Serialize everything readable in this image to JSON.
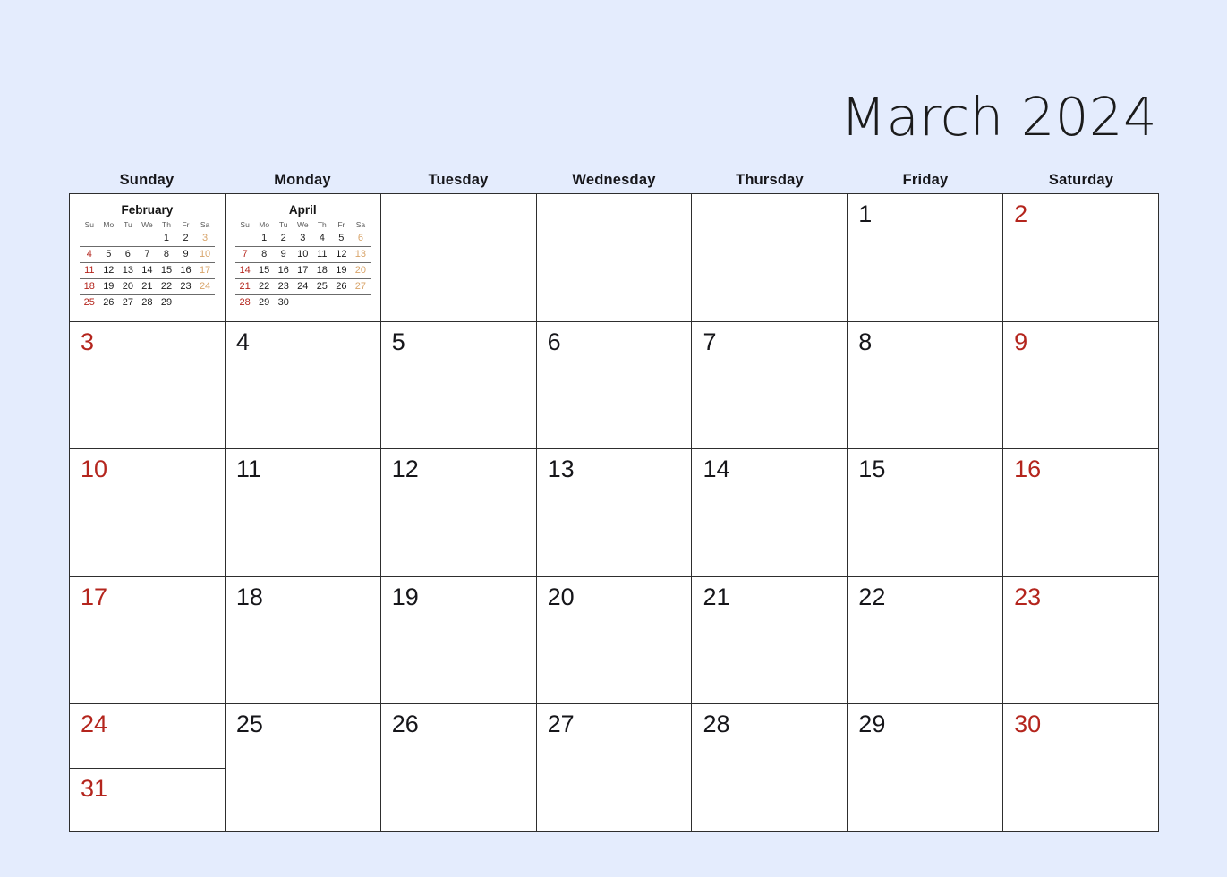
{
  "title": "March 2024",
  "background_color": "#e4ecfd",
  "weekend_color": "#b4251d",
  "weekday_color": "#16161a",
  "mini_saturday_color": "#d8a46a",
  "weekdays": [
    {
      "label": "Sunday"
    },
    {
      "label": "Monday"
    },
    {
      "label": "Tuesday"
    },
    {
      "label": "Wednesday"
    },
    {
      "label": "Thursday"
    },
    {
      "label": "Friday"
    },
    {
      "label": "Saturday"
    }
  ],
  "mini_calendars": {
    "previous": {
      "title": "February",
      "headers": [
        "Su",
        "Mo",
        "Tu",
        "We",
        "Th",
        "Fr",
        "Sa"
      ],
      "weeks": [
        [
          "",
          "",
          "",
          "",
          "1",
          "2",
          "3"
        ],
        [
          "4",
          "5",
          "6",
          "7",
          "8",
          "9",
          "10"
        ],
        [
          "11",
          "12",
          "13",
          "14",
          "15",
          "16",
          "17"
        ],
        [
          "18",
          "19",
          "20",
          "21",
          "22",
          "23",
          "24"
        ],
        [
          "25",
          "26",
          "27",
          "28",
          "29",
          "",
          ""
        ]
      ]
    },
    "next": {
      "title": "April",
      "headers": [
        "Su",
        "Mo",
        "Tu",
        "We",
        "Th",
        "Fr",
        "Sa"
      ],
      "weeks": [
        [
          "",
          "1",
          "2",
          "3",
          "4",
          "5",
          "6"
        ],
        [
          "7",
          "8",
          "9",
          "10",
          "11",
          "12",
          "13"
        ],
        [
          "14",
          "15",
          "16",
          "17",
          "18",
          "19",
          "20"
        ],
        [
          "21",
          "22",
          "23",
          "24",
          "25",
          "26",
          "27"
        ],
        [
          "28",
          "29",
          "30",
          "",
          "",
          "",
          ""
        ]
      ]
    }
  },
  "grid": {
    "rows": [
      {
        "cells": [
          {
            "type": "mini",
            "mini": "previous"
          },
          {
            "type": "mini",
            "mini": "next"
          },
          {
            "type": "empty",
            "number": ""
          },
          {
            "type": "empty",
            "number": ""
          },
          {
            "type": "empty",
            "number": ""
          },
          {
            "type": "day",
            "number": "1",
            "weekend": false
          },
          {
            "type": "day",
            "number": "2",
            "weekend": true
          }
        ]
      },
      {
        "cells": [
          {
            "type": "day",
            "number": "3",
            "weekend": true
          },
          {
            "type": "day",
            "number": "4",
            "weekend": false
          },
          {
            "type": "day",
            "number": "5",
            "weekend": false
          },
          {
            "type": "day",
            "number": "6",
            "weekend": false
          },
          {
            "type": "day",
            "number": "7",
            "weekend": false
          },
          {
            "type": "day",
            "number": "8",
            "weekend": false
          },
          {
            "type": "day",
            "number": "9",
            "weekend": true
          }
        ]
      },
      {
        "cells": [
          {
            "type": "day",
            "number": "10",
            "weekend": true
          },
          {
            "type": "day",
            "number": "11",
            "weekend": false
          },
          {
            "type": "day",
            "number": "12",
            "weekend": false
          },
          {
            "type": "day",
            "number": "13",
            "weekend": false
          },
          {
            "type": "day",
            "number": "14",
            "weekend": false
          },
          {
            "type": "day",
            "number": "15",
            "weekend": false
          },
          {
            "type": "day",
            "number": "16",
            "weekend": true
          }
        ]
      },
      {
        "cells": [
          {
            "type": "day",
            "number": "17",
            "weekend": true
          },
          {
            "type": "day",
            "number": "18",
            "weekend": false
          },
          {
            "type": "day",
            "number": "19",
            "weekend": false
          },
          {
            "type": "day",
            "number": "20",
            "weekend": false
          },
          {
            "type": "day",
            "number": "21",
            "weekend": false
          },
          {
            "type": "day",
            "number": "22",
            "weekend": false
          },
          {
            "type": "day",
            "number": "23",
            "weekend": true
          }
        ]
      },
      {
        "cells": [
          {
            "type": "split",
            "number": "24",
            "number2": "31",
            "weekend": true
          },
          {
            "type": "day",
            "number": "25",
            "weekend": false
          },
          {
            "type": "day",
            "number": "26",
            "weekend": false
          },
          {
            "type": "day",
            "number": "27",
            "weekend": false
          },
          {
            "type": "day",
            "number": "28",
            "weekend": false
          },
          {
            "type": "day",
            "number": "29",
            "weekend": false
          },
          {
            "type": "day",
            "number": "30",
            "weekend": true
          }
        ]
      }
    ]
  }
}
